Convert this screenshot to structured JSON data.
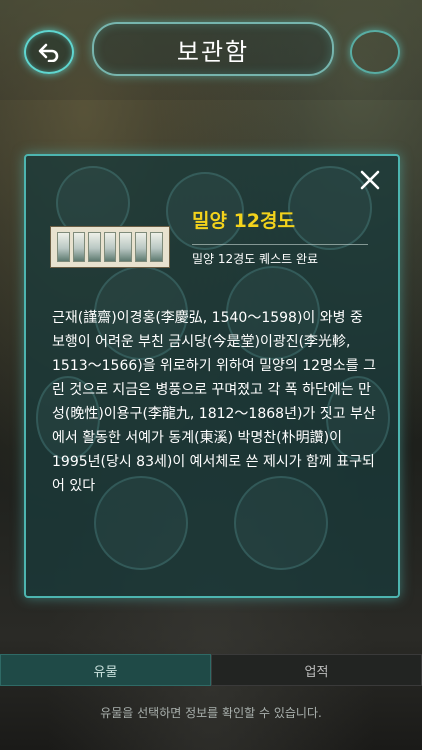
{
  "header": {
    "title": "보관함"
  },
  "modal": {
    "relic_name": "밀양 12경도",
    "status": "밀양 12경도 퀘스트 완료",
    "description": "근재(謹齋)이경홍(李慶弘, 1540～1598)이 와병 중 보행이 어려운 부친 금시당(今是堂)이광진(李光軫, 1513～1566)을 위로하기 위하여 밀양의 12명소를 그린 것으로 지금은 병풍으로 꾸며졌고 각 폭 하단에는 만성(晚性)이용구(李龍九, 1812～1868년)가 짓고 부산에서 활동한 서예가 동계(東溪) 박명찬(朴明讚)이 1995년(당시 83세)이 예서체로 쓴 제시가 함께 표구되어 있다"
  },
  "tabs": [
    {
      "label": "유물",
      "active": true
    },
    {
      "label": "업적",
      "active": false
    }
  ],
  "footer": {
    "hint": "유물을 선택하면 정보를 확인할 수 있습니다."
  },
  "colors": {
    "accent": "#4db5b0",
    "title_yellow": "#f2d21c",
    "tab_active": "#1f4a47"
  },
  "icons": {
    "back": "back-arrow-icon",
    "close": "close-icon"
  }
}
